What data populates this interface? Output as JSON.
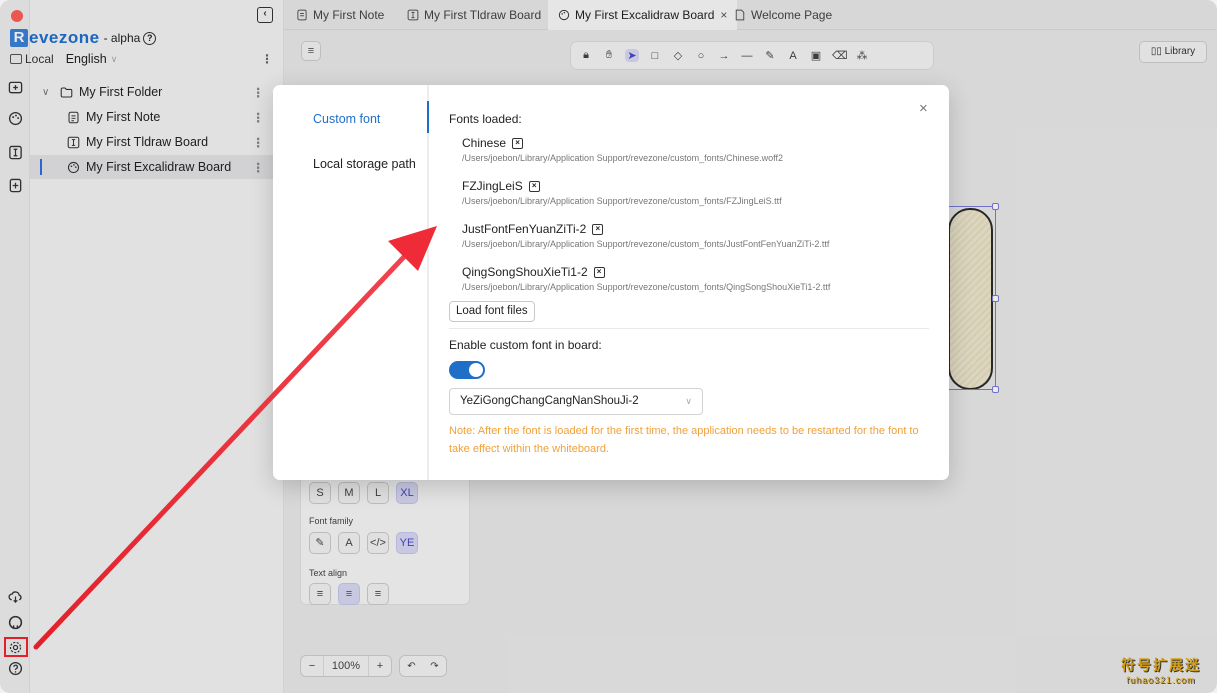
{
  "app": {
    "brand_initial": "R",
    "brand_rest": "evezone",
    "brand_tag": "- alpha",
    "workspace": "Local",
    "language": "English"
  },
  "sidebar": {
    "items": [
      {
        "label": "My First Folder",
        "icon": "folder-icon"
      },
      {
        "label": "My First Note",
        "icon": "note-icon"
      },
      {
        "label": "My First Tldraw Board",
        "icon": "tldraw-board-icon"
      },
      {
        "label": "My First Excalidraw Board",
        "icon": "excalidraw-palette-icon"
      }
    ],
    "rail_icons": [
      "add-folder-icon",
      "palette-icon",
      "board-icon",
      "add-file-icon",
      "cloud-download-icon",
      "github-icon",
      "settings-icon",
      "help-icon"
    ]
  },
  "tabs": [
    {
      "label": "My First Note",
      "icon": "note-icon"
    },
    {
      "label": "My First Tldraw Board",
      "icon": "tldraw-board-icon"
    },
    {
      "label": "My First Excalidraw Board",
      "icon": "excalidraw-palette-icon",
      "active": true,
      "close": "×"
    },
    {
      "label": "Welcome Page",
      "icon": "page-icon"
    }
  ],
  "canvas": {
    "menu_symbol": "≡",
    "library_label": "Library",
    "toolbar": [
      "lock-icon",
      "hand-icon",
      "selection-icon",
      "rectangle-icon",
      "diamond-icon",
      "ellipse-icon",
      "arrow-icon",
      "line-icon",
      "draw-icon",
      "text-icon",
      "image-icon",
      "eraser-icon",
      "extra-tools-icon"
    ],
    "font_size_buttons": [
      "S",
      "M",
      "L",
      "XL"
    ],
    "font_family_label": "Font family",
    "font_family_buttons": [
      "✎",
      "A",
      "</>",
      "YE"
    ],
    "text_align_label": "Text align",
    "zoom_minus": "−",
    "zoom_value": "100%",
    "zoom_plus": "+",
    "undo": "↶",
    "redo": "↷"
  },
  "settings_modal": {
    "nav": [
      "Custom font",
      "Local storage path"
    ],
    "close": "×",
    "fonts_loaded_label": "Fonts loaded:",
    "fonts": [
      {
        "name": "Chinese",
        "path": "/Users/joebon/Library/Application Support/revezone/custom_fonts/Chinese.woff2"
      },
      {
        "name": "FZJingLeiS",
        "path": "/Users/joebon/Library/Application Support/revezone/custom_fonts/FZJingLeiS.ttf"
      },
      {
        "name": "JustFontFenYuanZiTi-2",
        "path": "/Users/joebon/Library/Application Support/revezone/custom_fonts/JustFontFenYuanZiTi-2.ttf"
      },
      {
        "name": "QingSongShouXieTi1-2",
        "path": "/Users/joebon/Library/Application Support/revezone/custom_fonts/QingSongShouXieTi1-2.ttf"
      }
    ],
    "remove_symbol": "×",
    "load_button": "Load font files",
    "enable_label": "Enable custom font in board:",
    "toggle_on": true,
    "selected_font": "YeZiGongChangCangNanShouJi-2",
    "note": "Note: After the font is loaded for the first time, the application needs to be restarted for the font to take effect within the whiteboard."
  },
  "watermark": {
    "cn": "符号扩展迷",
    "en": "fuhao321.com"
  },
  "colors": {
    "accent": "#1f6fc9",
    "brand": "#1f6fd0",
    "annotation": "#e3202a",
    "note": "#f0a13a"
  }
}
